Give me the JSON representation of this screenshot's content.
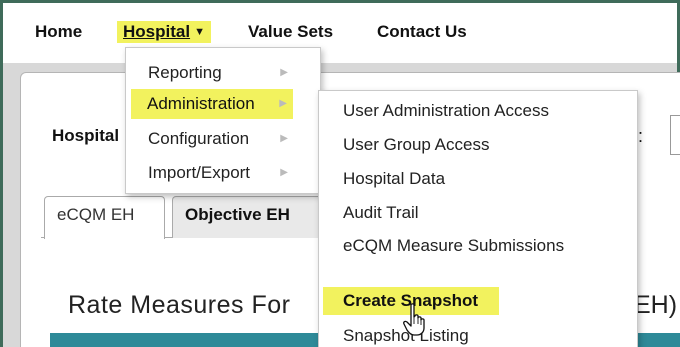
{
  "nav": {
    "home": "Home",
    "hospital": "Hospital",
    "value_sets": "Value Sets",
    "contact_us": "Contact Us"
  },
  "page": {
    "hospital_label": "Hospital",
    "right_label": "e:",
    "tabs": [
      "eCQM EH",
      "Objective EH"
    ],
    "rate_title": "Rate Measures For",
    "rate_suffix": "EH)"
  },
  "hospital_menu": [
    {
      "label": "Reporting"
    },
    {
      "label": "Administration",
      "highlighted": true
    },
    {
      "label": "Configuration"
    },
    {
      "label": "Import/Export"
    }
  ],
  "admin_menu": [
    {
      "label": "User Administration Access"
    },
    {
      "label": "User Group Access"
    },
    {
      "label": "Hospital Data"
    },
    {
      "label": "Audit Trail"
    },
    {
      "label": "eCQM Measure Submissions"
    },
    {
      "label": ""
    },
    {
      "label": "Create Snapshot",
      "highlighted": true
    },
    {
      "label": "Snapshot Listing"
    }
  ],
  "icons": {
    "submenu_arrow": "chevron-right-icon",
    "nav_caret": "caret-down-icon",
    "cursor": "hand-pointer-icon"
  },
  "colors": {
    "highlight": "#f2f25e",
    "frame": "#3f6b5a",
    "teal_bar": "#2e8a98"
  }
}
